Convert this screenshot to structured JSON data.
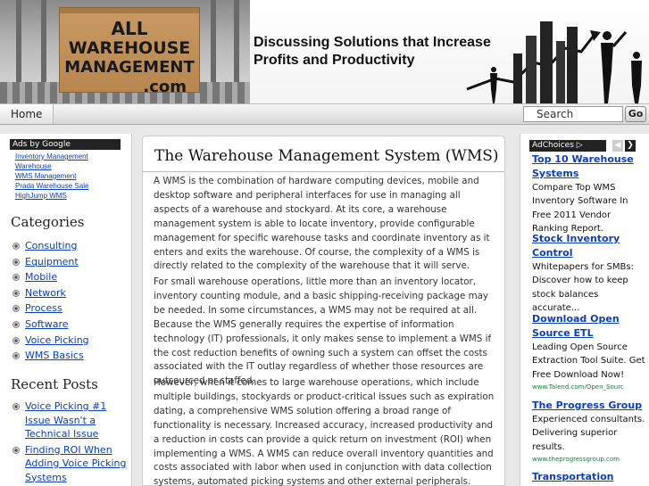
{
  "header": {
    "logo_line1": "ALL",
    "logo_line2": "WAREHOUSE",
    "logo_line3": "MANAGEMENT",
    "logo_line4": ".com",
    "tagline_line1": "Discussing Solutions that Increase",
    "tagline_line2": "Profits and Productivity"
  },
  "nav": {
    "home_label": "Home",
    "search_value": "Search",
    "go_label": "Go"
  },
  "left_sidebar": {
    "ads_title": "Ads by Google",
    "ad_links": [
      "Inventory Management",
      "Warehouse",
      "WMS Management",
      "Prada Warehouse Sale",
      "HighJump WMS"
    ],
    "categories_heading": "Categories",
    "categories": [
      "Consulting",
      "Equipment",
      "Mobile",
      "Network",
      "Process",
      "Software",
      "Voice Picking",
      "WMS Basics"
    ],
    "recent_heading": "Recent Posts",
    "recent_posts": [
      "Voice Picking #1 Issue Wasn't a Technical Issue",
      "Finding ROI When Adding Voice Picking Systems"
    ]
  },
  "main": {
    "title": "The Warehouse Management System (WMS)",
    "paragraphs": [
      "A WMS is the combination of hardware computing devices, mobile and desktop software and peripheral interfaces for use in managing all aspects of a warehouse and stockyard.  At its core, a warehouse management system is able to locate inventory, provide configurable management for specific warehouse tasks and coordinate inventory as it enters and exits the warehouse. Of course, the complexity of a WMS is directly related to the complexity of the warehouse that it will serve.",
      "For small warehouse operations, little more than an inventory locator, inventory counting module, and a basic shipping-receiving package may be needed.  In some circumstances, a WMS may not be required at all.  Because the WMS generally requires the expertise of information technology (IT) professionals, it only makes sense to implement a WMS if the cost reduction benefits of owning such a system can offset the costs associated with the IT outlay regardless of whether those resources are outsourced or staffed.",
      "However, when it comes to large warehouse operations, which include multiple buildings, stockyards or product-critical issues such as expiration dating, a comprehensive WMS solution offering a broad range of functionality is necessary. Increased accuracy, increased productivity and a reduction in costs can provide a quick return on investment (ROI) when implementing a WMS. A WMS can reduce overall inventory quantities and costs associated with labor when used in conjunction with data collection systems, automated picking systems and other external peripherals."
    ]
  },
  "right_sidebar": {
    "adchoices_label": "AdChoices",
    "prev_label": "◀",
    "next_label": "❯",
    "ads": [
      {
        "title": "Top 10 Warehouse Systems",
        "body": "Compare Top WMS Inventory Software In Free 2011 Vendor Ranking Report.",
        "url": ""
      },
      {
        "title": "Stock Inventory Control",
        "body": "Whitepapers for SMBs: Discover how to keep stock balances accurate...",
        "url": ""
      },
      {
        "title": "Download Open Source ETL",
        "body": "Leading Open Source Extraction Tool Suite. Get Free Download Now!",
        "url": "www.Talend.com/Open_Sourc"
      },
      {
        "title": "The Progress Group",
        "body": "Experienced consultants. Delivering superior results.",
        "url": "www.theprogressgroup.com"
      },
      {
        "title": "Transportation",
        "body": "",
        "url": ""
      }
    ]
  },
  "colors": {
    "link": "#0a3fb5",
    "ad_url": "#16803a",
    "box": "#c89a63"
  }
}
